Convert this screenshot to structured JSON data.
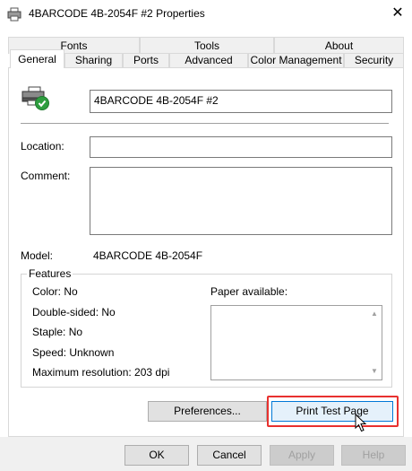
{
  "window": {
    "title": "4BARCODE 4B-2054F #2 Properties",
    "close_glyph": "✕"
  },
  "tabs": {
    "row1": [
      {
        "label": "Fonts"
      },
      {
        "label": "Tools"
      },
      {
        "label": "About"
      }
    ],
    "row2": [
      {
        "label": "General",
        "active": true
      },
      {
        "label": "Sharing"
      },
      {
        "label": "Ports"
      },
      {
        "label": "Advanced"
      },
      {
        "label": "Color Management"
      },
      {
        "label": "Security"
      }
    ]
  },
  "general": {
    "printer_name": "4BARCODE 4B-2054F #2",
    "location_label": "Location:",
    "location_value": "",
    "comment_label": "Comment:",
    "comment_value": "",
    "model_label": "Model:",
    "model_value": "4BARCODE 4B-2054F"
  },
  "features": {
    "legend": "Features",
    "color": "Color: No",
    "double_sided": "Double-sided: No",
    "staple": "Staple: No",
    "speed": "Speed: Unknown",
    "max_resolution": "Maximum resolution: 203 dpi",
    "paper_available_label": "Paper available:"
  },
  "buttons": {
    "preferences": "Preferences...",
    "print_test_page": "Print Test Page",
    "ok": "OK",
    "cancel": "Cancel",
    "apply": "Apply",
    "help": "Help"
  },
  "colors": {
    "highlight": "#e8312f",
    "focus": "#0078d7",
    "ok_check": "#2e9e3f"
  },
  "icons": {
    "title": "printer-icon",
    "printer_status": "printer-ready-icon",
    "cursor": "mouse-pointer-icon"
  }
}
